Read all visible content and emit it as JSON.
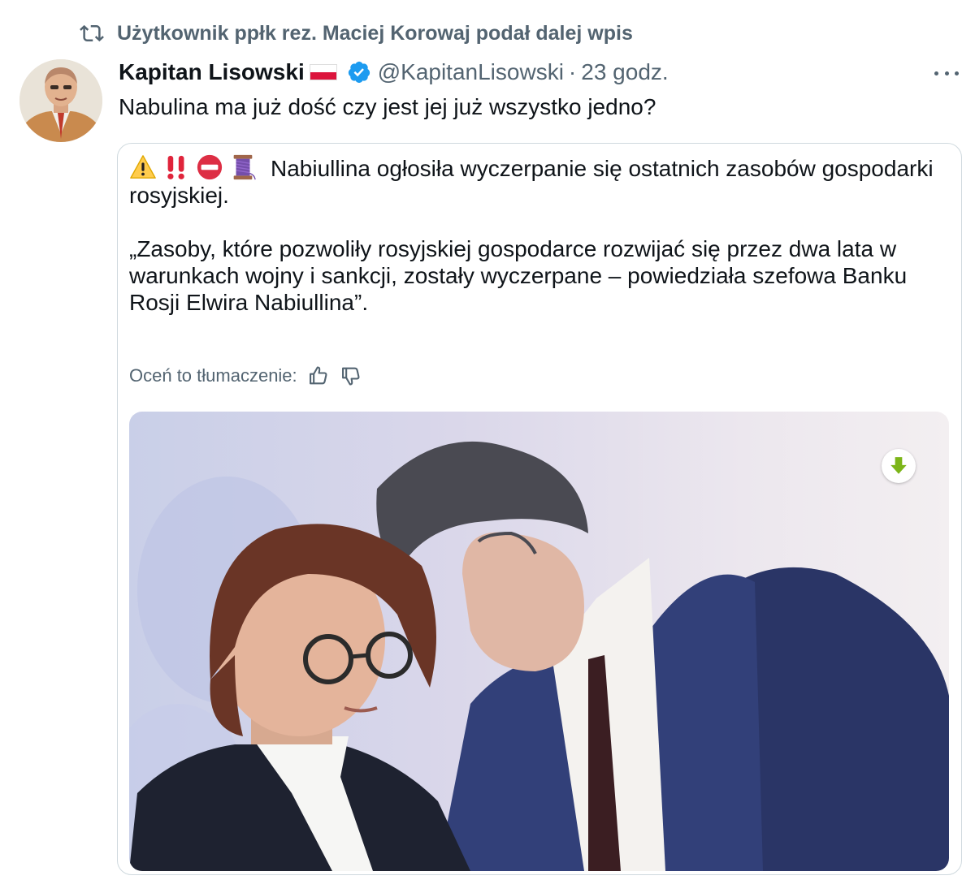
{
  "retweet": {
    "icon": "retweet-icon",
    "text": "Użytkownik ppłk rez. Maciej Korowaj podał dalej wpis"
  },
  "author": {
    "name": "Kapitan Lisowski",
    "flag": "flag-poland-icon",
    "verified": true,
    "handle": "@KapitanLisowski",
    "separator": "·",
    "time": "23 godz."
  },
  "tweet": {
    "text": "Nabulina ma już dość czy jest jej już wszystko jedno?"
  },
  "quote": {
    "emojis": [
      "warning-icon",
      "double-exclamation-icon",
      "no-entry-icon",
      "thread-spool-icon"
    ],
    "paragraph1": "Nabiullina ogłosiła wyczerpanie się ostatnich zasobów gospodarki rosyjskiej.",
    "paragraph2": "„Zasoby, które pozwoliły rosyjskiej gospodarce rozwijać się przez dwa lata w warunkach wojny i sankcji, zostały wyczerpane – powiedziała szefowa Banku Rosji Elwira Nabiullina”.",
    "rate_label": "Oceń to tłumaczenie:",
    "rate_icons": [
      "thumbs-up-icon",
      "thumbs-down-icon"
    ],
    "image": {
      "icon": "download-arrow-icon"
    }
  },
  "colors": {
    "text": "#0f1419",
    "secondary": "#536471",
    "border": "#cfd9de",
    "verified": "#1d9bf0",
    "download": "#7cb518"
  }
}
